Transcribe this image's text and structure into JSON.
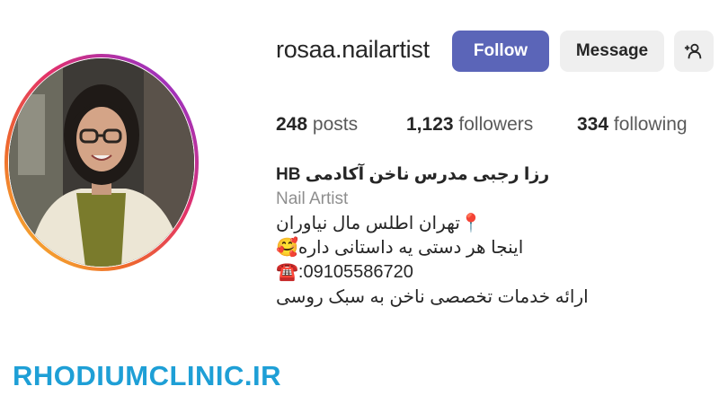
{
  "profile": {
    "username": "rosaa.nailartist",
    "avatar_icon": "profile-photo"
  },
  "actions": {
    "follow_label": "Follow",
    "message_label": "Message",
    "add_user_icon": "add-user-icon"
  },
  "stats": {
    "posts_count": "248",
    "posts_label": "posts",
    "followers_count": "1,123",
    "followers_label": "followers",
    "following_count": "334",
    "following_label": "following"
  },
  "bio": {
    "name": "رزا رجبی مدرس ناخن آکادمی HB",
    "category": "Nail Artist",
    "line1": "📍تهران اطلس مال نیاوران",
    "line2": "اینجا هر دستی یه داستانی داره🥰",
    "line3": "☎️:09105586720",
    "line4": "ارائه خدمات تخصصی ناخن به سبک روسی"
  },
  "watermark": {
    "text": "RHODIUMCLINIC.IR"
  },
  "colors": {
    "follow_bg": "#5b65b8",
    "secondary_btn_bg": "#efefef",
    "watermark": "#1e9fd6"
  }
}
